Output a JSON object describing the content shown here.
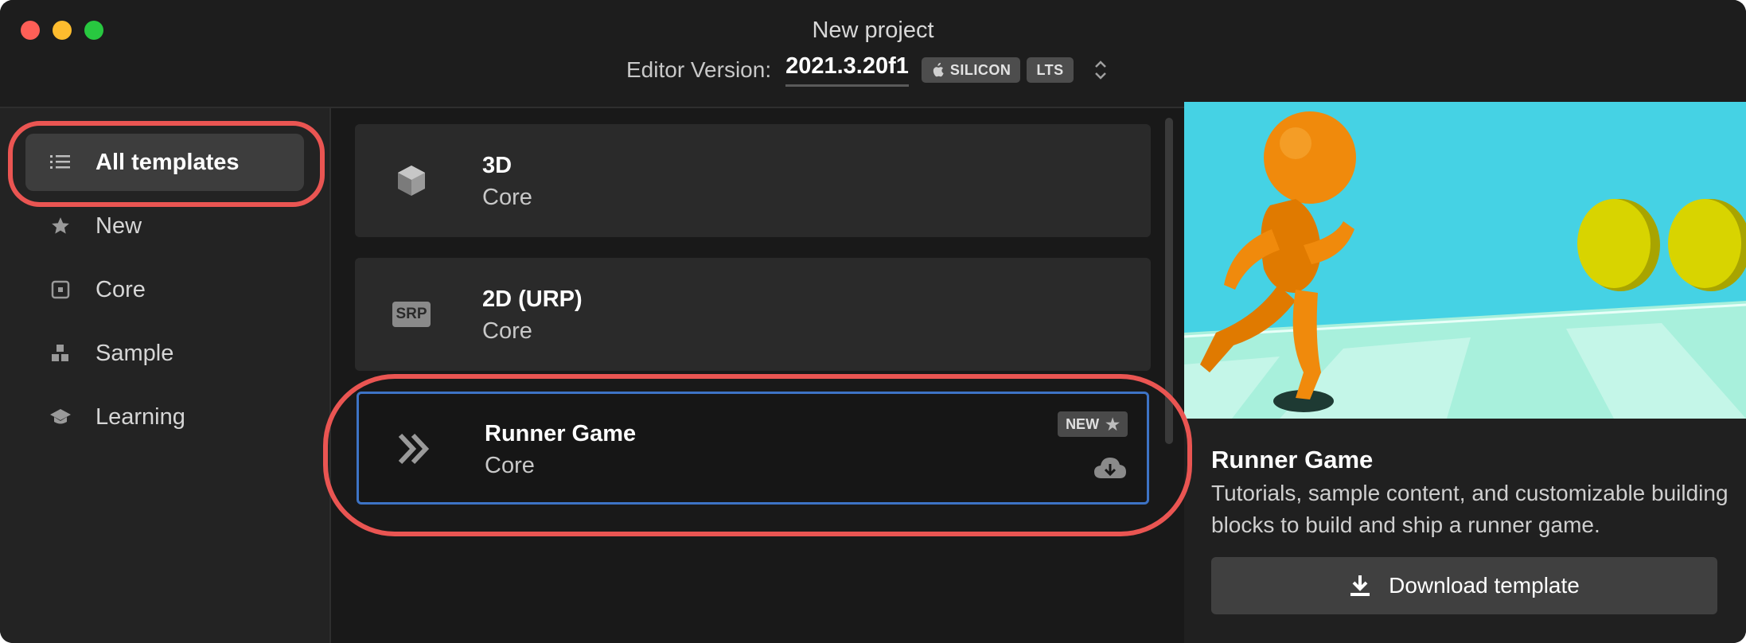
{
  "window": {
    "title": "New project"
  },
  "editor": {
    "label": "Editor Version:",
    "version": "2021.3.20f1",
    "badges": [
      "SILICON",
      "LTS"
    ]
  },
  "sidebar": {
    "items": [
      {
        "label": "All templates",
        "icon": "list-icon",
        "active": true
      },
      {
        "label": "New",
        "icon": "star-icon",
        "active": false
      },
      {
        "label": "Core",
        "icon": "core-square-icon",
        "active": false
      },
      {
        "label": "Sample",
        "icon": "blocks-icon",
        "active": false
      },
      {
        "label": "Learning",
        "icon": "graduation-cap-icon",
        "active": false
      }
    ]
  },
  "templates": [
    {
      "name": "3D",
      "category": "Core",
      "icon": "cube-icon"
    },
    {
      "name": "2D (URP)",
      "category": "Core",
      "icon": "srp-icon",
      "icon_text": "SRP"
    },
    {
      "name": "Runner Game",
      "category": "Core",
      "icon": "double-chevron-icon",
      "tag": "NEW",
      "selected": true
    }
  ],
  "preview": {
    "title": "Runner Game",
    "description": "Tutorials, sample content, and customizable building blocks to build and ship a runner game.",
    "download_label": "Download template"
  },
  "colors": {
    "highlight": "#ea5552",
    "selection_border": "#3d73c5",
    "sky": "#45d2e4",
    "floor": "#a8f0dc",
    "character": "#f08a0c",
    "coin": "#d8d400"
  }
}
